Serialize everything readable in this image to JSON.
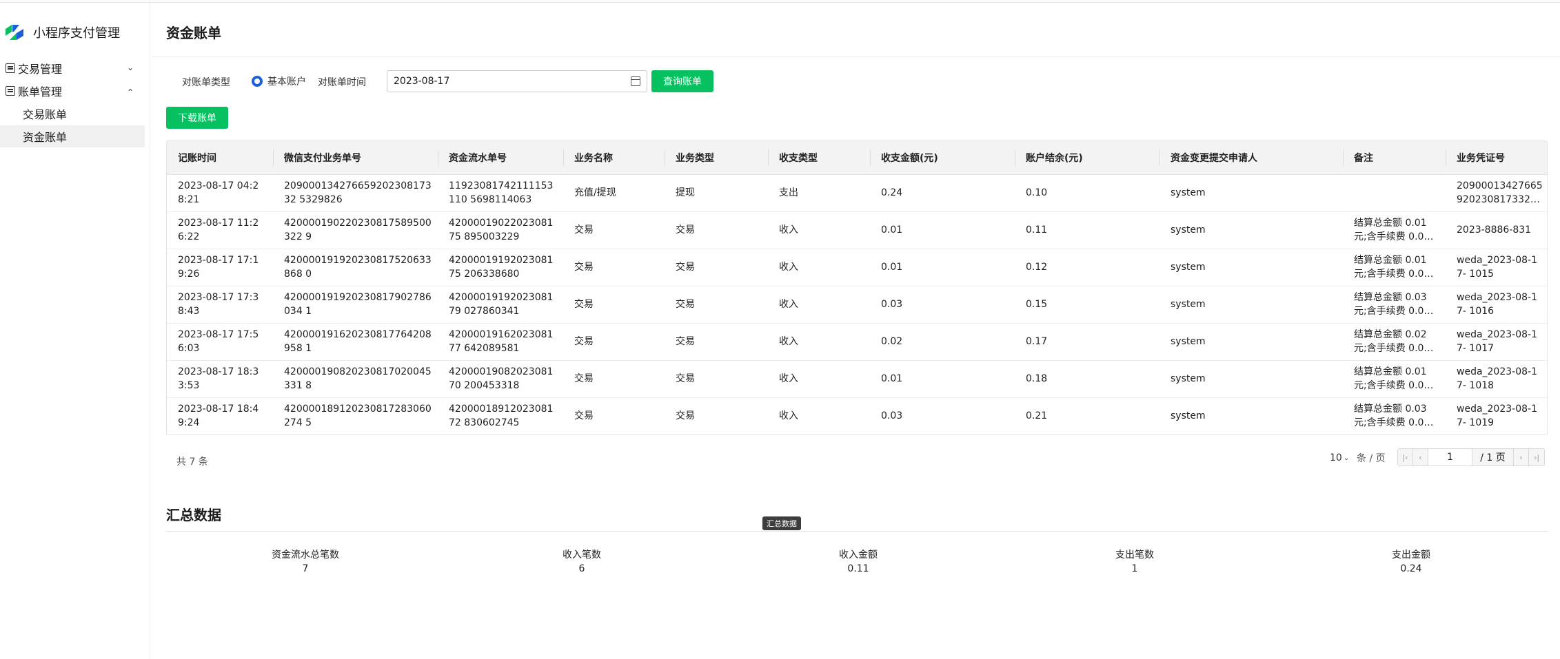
{
  "sidebar": {
    "title": "小程序支付管理",
    "menus": [
      {
        "label": "交易管理",
        "expanded": false
      },
      {
        "label": "账单管理",
        "expanded": true
      }
    ],
    "subitems": [
      "交易账单",
      "资金账单"
    ],
    "active_subitem": "资金账单"
  },
  "page": {
    "title": "资金账单"
  },
  "filters": {
    "bill_type_label": "对账单类型",
    "bill_type_value": "基本账户",
    "bill_time_label": "对账单时间",
    "bill_date": "2023-08-17",
    "query_button": "查询账单",
    "download_button": "下载账单"
  },
  "table": {
    "columns": [
      "记账时间",
      "微信支付业务单号",
      "资金流水单号",
      "业务名称",
      "业务类型",
      "收支类型",
      "收支金额(元)",
      "账户结余(元)",
      "资金变更提交申请人",
      "备注",
      "业务凭证号"
    ],
    "rows": [
      [
        "2023-08-17 04:28:21",
        "20900013427665920230817332 5329826",
        "11923081742111153110 5698114063",
        "充值/提现",
        "提现",
        "支出",
        "0.24",
        "0.10",
        "system",
        "",
        "2090001342766592023081733253…"
      ],
      [
        "2023-08-17 11:26:22",
        "420000190220230817589500322 9",
        "4200001902202308175 895003229",
        "交易",
        "交易",
        "收入",
        "0.01",
        "0.11",
        "system",
        "结算总金额 0.01 元;含手续费 0.0…",
        "2023-8886-831"
      ],
      [
        "2023-08-17 17:19:26",
        "420000191920230817520633868 0",
        "4200001919202308175 206338680",
        "交易",
        "交易",
        "收入",
        "0.01",
        "0.12",
        "system",
        "结算总金额 0.01 元;含手续费 0.0…",
        "weda_2023-08-17- 1015"
      ],
      [
        "2023-08-17 17:38:43",
        "420000191920230817902786034 1",
        "4200001919202308179 027860341",
        "交易",
        "交易",
        "收入",
        "0.03",
        "0.15",
        "system",
        "结算总金额 0.03 元;含手续费 0.0…",
        "weda_2023-08-17- 1016"
      ],
      [
        "2023-08-17 17:56:03",
        "420000191620230817764208958 1",
        "4200001916202308177 642089581",
        "交易",
        "交易",
        "收入",
        "0.02",
        "0.17",
        "system",
        "结算总金额 0.02 元;含手续费 0.0…",
        "weda_2023-08-17- 1017"
      ],
      [
        "2023-08-17 18:33:53",
        "420000190820230817020045331 8",
        "4200001908202308170 200453318",
        "交易",
        "交易",
        "收入",
        "0.01",
        "0.18",
        "system",
        "结算总金额 0.01 元;含手续费 0.0…",
        "weda_2023-08-17- 1018"
      ],
      [
        "2023-08-17 18:49:24",
        "420000189120230817283060274 5",
        "4200001891202308172 830602745",
        "交易",
        "交易",
        "收入",
        "0.03",
        "0.21",
        "system",
        "结算总金额 0.03 元;含手续费 0.0…",
        "weda_2023-08-17- 1019"
      ]
    ]
  },
  "pagination": {
    "total_text": "共 7 条",
    "page_size": "10",
    "page_unit": "条 / 页",
    "current_page": "1",
    "total_pages_text": "/ 1 页"
  },
  "summary": {
    "title": "汇总数据",
    "tooltip": "汇总数据",
    "stats": [
      {
        "label": "资金流水总笔数",
        "value": "7"
      },
      {
        "label": "收入笔数",
        "value": "6"
      },
      {
        "label": "收入金额",
        "value": "0.11"
      },
      {
        "label": "支出笔数",
        "value": "1"
      },
      {
        "label": "支出金额",
        "value": "0.24"
      }
    ]
  },
  "colors": {
    "primary": "#07c160",
    "radio": "#1d5fd8"
  }
}
